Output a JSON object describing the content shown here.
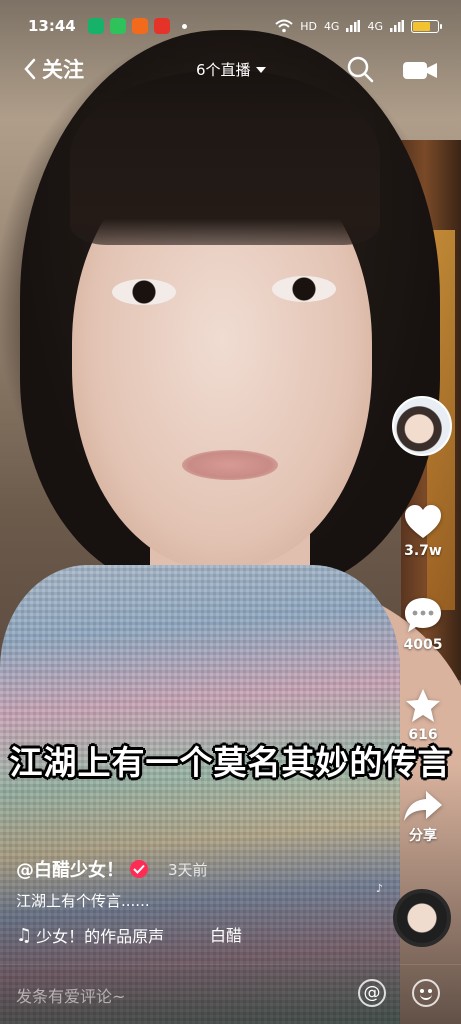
{
  "status_bar": {
    "time": "13:44",
    "network": "HD",
    "signal_1": "4G",
    "signal_2": "4G",
    "battery_level": 0.7,
    "battery_color": "#f2c230"
  },
  "nav": {
    "back_label": "关注",
    "live_label": "6个直播",
    "search_icon": "search-icon",
    "camera_icon": "camera-icon"
  },
  "actions": {
    "like_count": "3.7w",
    "comment_count": "4005",
    "favorite_count": "616",
    "share_label": "分享",
    "like_color": "#ffffff"
  },
  "caption": "江湖上有一个莫名其妙的传言",
  "post": {
    "author": "@白醋少女！",
    "time_ago": "3天前",
    "description": "江湖上有个传言......",
    "music": "少女！的作品原声",
    "music_tail": "白醋",
    "verified_color": "#fe2c55"
  },
  "comment_bar": {
    "placeholder": "发条有爱评论~",
    "at_symbol": "@"
  }
}
